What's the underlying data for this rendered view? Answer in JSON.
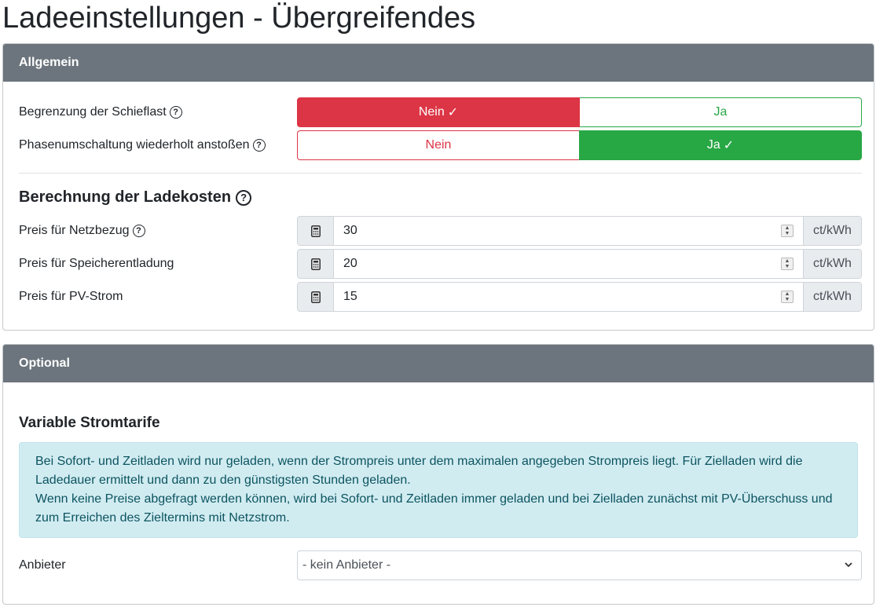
{
  "page_title": "Ladeeinstellungen - Übergreifendes",
  "general": {
    "header": "Allgemein",
    "unbalanced_load": {
      "label": "Begrenzung der Schieflast",
      "no_label": "Nein",
      "yes_label": "Ja",
      "selected": "Nein"
    },
    "phase_switch": {
      "label": "Phasenumschaltung wiederholt anstoßen",
      "no_label": "Nein",
      "yes_label": "Ja",
      "selected": "Ja"
    },
    "cost_section": {
      "title": "Berechnung der Ladekosten",
      "rows": [
        {
          "label": "Preis für Netzbezug",
          "value": "30",
          "unit": "ct/kWh",
          "has_help": true
        },
        {
          "label": "Preis für Speicherentladung",
          "value": "20",
          "unit": "ct/kWh",
          "has_help": false
        },
        {
          "label": "Preis für PV-Strom",
          "value": "15",
          "unit": "ct/kWh",
          "has_help": false
        }
      ]
    }
  },
  "optional": {
    "header": "Optional",
    "tariffs_title": "Variable Stromtarife",
    "info_line1": "Bei Sofort- und Zeitladen wird nur geladen, wenn der Strompreis unter dem maximalen angegeben Strompreis liegt. Für Zielladen wird die Ladedauer ermittelt und dann zu den günstigsten Stunden geladen.",
    "info_line2": "Wenn keine Preise abgefragt werden können, wird bei Sofort- und Zeitladen immer geladen und bei Zielladen zunächst mit PV-Überschuss und zum Erreichen des Zieltermins mit Netzstrom.",
    "provider_label": "Anbieter",
    "provider_selected": "- kein Anbieter -"
  },
  "icons": {
    "help": "question-circle-icon",
    "calculator": "calculator-icon",
    "check": "check-icon",
    "chevron": "chevron-down-icon"
  },
  "colors": {
    "header_bg": "#6c757d",
    "danger": "#dc3545",
    "success": "#28a745",
    "info_bg": "#d1ecf1",
    "info_text": "#0c5460"
  }
}
